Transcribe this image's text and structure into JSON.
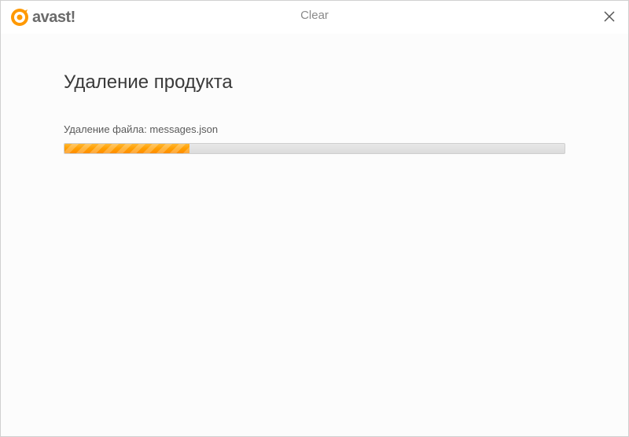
{
  "header": {
    "logo_text": "avast!",
    "window_title": "Clear"
  },
  "content": {
    "main_title": "Удаление продукта",
    "status_text": "Удаление файла: messages.json",
    "progress_percent": 25
  },
  "colors": {
    "accent_orange": "#ff9900",
    "text_gray": "#6b6b6b"
  }
}
